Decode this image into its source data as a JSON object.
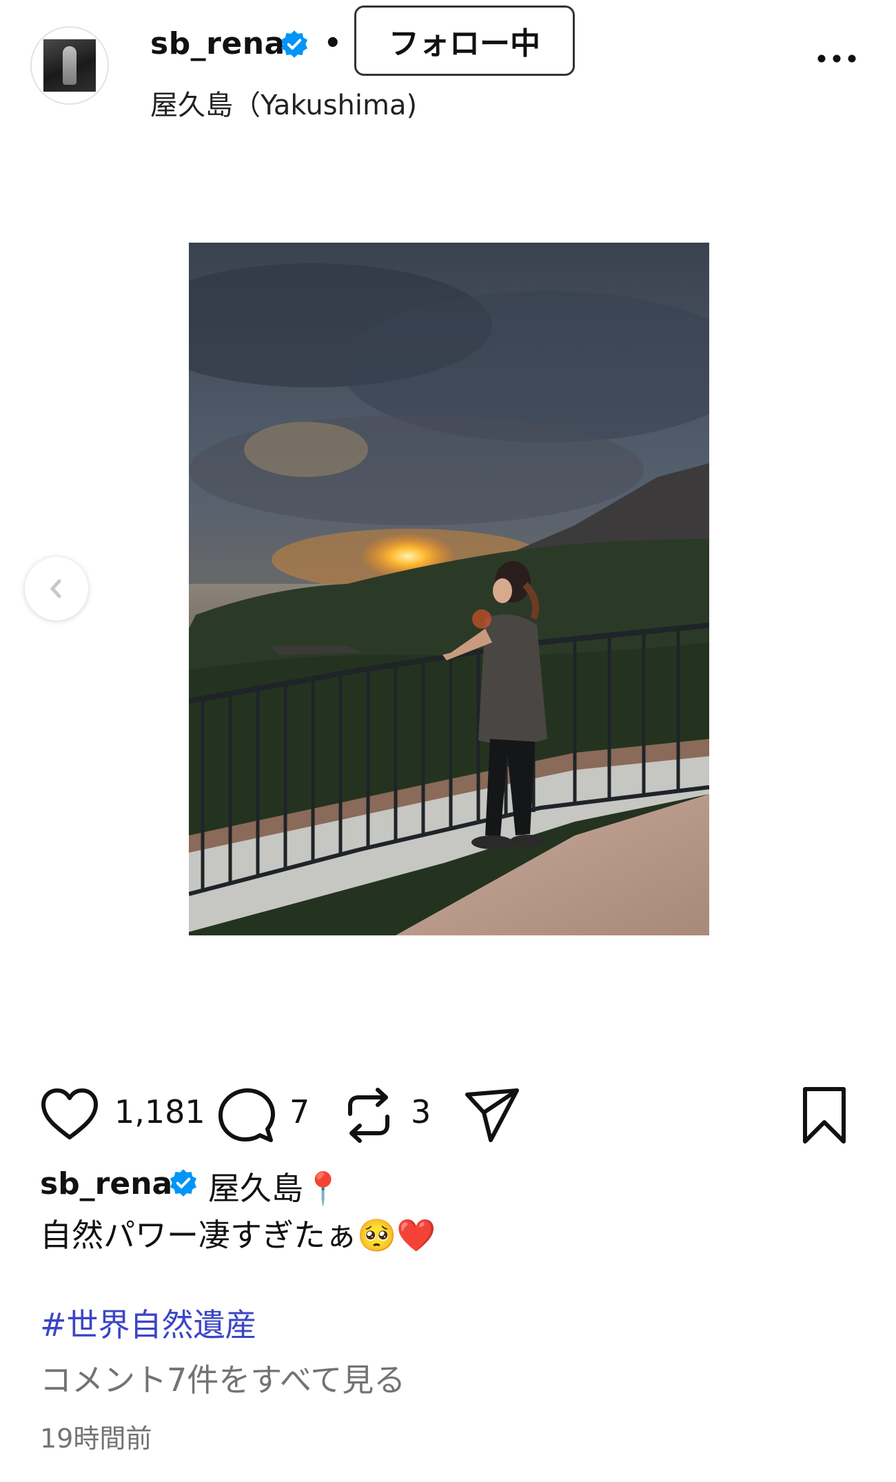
{
  "post": {
    "username": "sb_rena",
    "separator": "•",
    "follow_label": "フォロー中",
    "location": "屋久島（Yakushima)",
    "likes": "1,181",
    "comments": "7",
    "reposts": "3",
    "caption_user": "sb_rena",
    "caption_location": "屋久島📍",
    "caption_text": "自然パワー凄すぎたぁ🥺❤️",
    "hashtag": "#世界自然遺産",
    "view_comments": "コメント7件をすべて見る",
    "timestamp": "19時間前"
  },
  "colors": {
    "verified_blue": "#0095f6",
    "hashtag": "#3b45c6",
    "muted_text": "#737373"
  },
  "icons": [
    "verified-badge-icon",
    "more-options-icon",
    "chevron-left-icon",
    "heart-icon",
    "comment-icon",
    "repost-icon",
    "share-icon",
    "bookmark-icon"
  ]
}
